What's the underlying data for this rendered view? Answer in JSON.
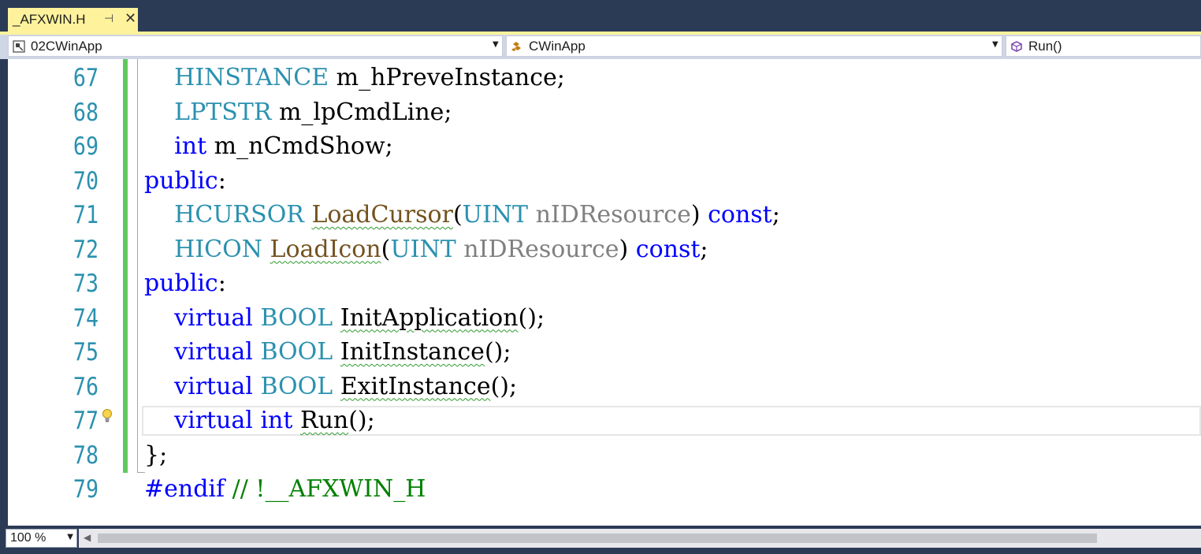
{
  "tab": {
    "title": "_AFXWIN.H",
    "pin_glyph": "⊣",
    "close_glyph": "✕"
  },
  "navbar": {
    "project": "02CWinApp",
    "class_scope": "CWinApp",
    "member": "Run()"
  },
  "editor": {
    "line_numbers": [
      "67",
      "68",
      "69",
      "70",
      "71",
      "72",
      "73",
      "74",
      "75",
      "76",
      "77",
      "78",
      "79"
    ],
    "lines": [
      {
        "indent": "    ",
        "parts": [
          {
            "t": "HINSTANCE",
            "c": "ty"
          },
          {
            "t": " m_hPreveInstance;",
            "c": ""
          }
        ]
      },
      {
        "indent": "    ",
        "parts": [
          {
            "t": "LPTSTR",
            "c": "ty"
          },
          {
            "t": " m_lpCmdLine;",
            "c": ""
          }
        ]
      },
      {
        "indent": "    ",
        "parts": [
          {
            "t": "int",
            "c": "kw"
          },
          {
            "t": " m_nCmdShow;",
            "c": ""
          }
        ]
      },
      {
        "indent": "",
        "parts": [
          {
            "t": "public",
            "c": "kw"
          },
          {
            "t": ":",
            "c": ""
          }
        ]
      },
      {
        "indent": "    ",
        "parts": [
          {
            "t": "HCURSOR",
            "c": "ty"
          },
          {
            "t": " ",
            "c": ""
          },
          {
            "t": "LoadCursor",
            "c": "fn squig"
          },
          {
            "t": "(",
            "c": ""
          },
          {
            "t": "UINT",
            "c": "ty"
          },
          {
            "t": " nIDResource",
            "c": "pa"
          },
          {
            "t": ") ",
            "c": ""
          },
          {
            "t": "const",
            "c": "kw"
          },
          {
            "t": ";",
            "c": ""
          }
        ]
      },
      {
        "indent": "    ",
        "parts": [
          {
            "t": "HICON",
            "c": "ty"
          },
          {
            "t": " ",
            "c": ""
          },
          {
            "t": "LoadIcon",
            "c": "fn squig"
          },
          {
            "t": "(",
            "c": ""
          },
          {
            "t": "UINT",
            "c": "ty"
          },
          {
            "t": " nIDResource",
            "c": "pa"
          },
          {
            "t": ") ",
            "c": ""
          },
          {
            "t": "const",
            "c": "kw"
          },
          {
            "t": ";",
            "c": ""
          }
        ]
      },
      {
        "indent": "",
        "parts": [
          {
            "t": "public",
            "c": "kw"
          },
          {
            "t": ":",
            "c": ""
          }
        ]
      },
      {
        "indent": "    ",
        "parts": [
          {
            "t": "virtual",
            "c": "kw"
          },
          {
            "t": " ",
            "c": ""
          },
          {
            "t": "BOOL",
            "c": "ty"
          },
          {
            "t": " ",
            "c": ""
          },
          {
            "t": "InitApplication",
            "c": "squig"
          },
          {
            "t": "();",
            "c": ""
          }
        ]
      },
      {
        "indent": "    ",
        "parts": [
          {
            "t": "virtual",
            "c": "kw"
          },
          {
            "t": " ",
            "c": ""
          },
          {
            "t": "BOOL",
            "c": "ty"
          },
          {
            "t": " ",
            "c": ""
          },
          {
            "t": "InitInstance",
            "c": "squig"
          },
          {
            "t": "();",
            "c": ""
          }
        ]
      },
      {
        "indent": "    ",
        "parts": [
          {
            "t": "virtual",
            "c": "kw"
          },
          {
            "t": " ",
            "c": ""
          },
          {
            "t": "BOOL",
            "c": "ty"
          },
          {
            "t": " ",
            "c": ""
          },
          {
            "t": "ExitInstance",
            "c": "squig"
          },
          {
            "t": "();",
            "c": ""
          }
        ]
      },
      {
        "indent": "    ",
        "parts": [
          {
            "t": "virtual",
            "c": "kw"
          },
          {
            "t": " ",
            "c": ""
          },
          {
            "t": "int",
            "c": "kw"
          },
          {
            "t": " ",
            "c": ""
          },
          {
            "t": "Run",
            "c": "squig"
          },
          {
            "t": "();",
            "c": ""
          }
        ]
      },
      {
        "indent": "",
        "parts": [
          {
            "t": "};",
            "c": ""
          }
        ]
      },
      {
        "indent": "",
        "parts": [
          {
            "t": "#endif",
            "c": "kw"
          },
          {
            "t": " // !__AFXWIN_H",
            "c": "cm"
          }
        ]
      }
    ]
  },
  "status": {
    "zoom": "100 %"
  },
  "colors": {
    "keyword": "#0000ff",
    "type": "#2b91af",
    "comment": "#008000",
    "param": "#808080",
    "tab_active": "#fff29d",
    "change_bar": "#5fc95f"
  },
  "icons": [
    "pin-icon",
    "close-icon",
    "project-icon",
    "class-scope-icon",
    "member-icon",
    "chevron-down-icon",
    "lightbulb-icon",
    "scroll-left-icon"
  ]
}
